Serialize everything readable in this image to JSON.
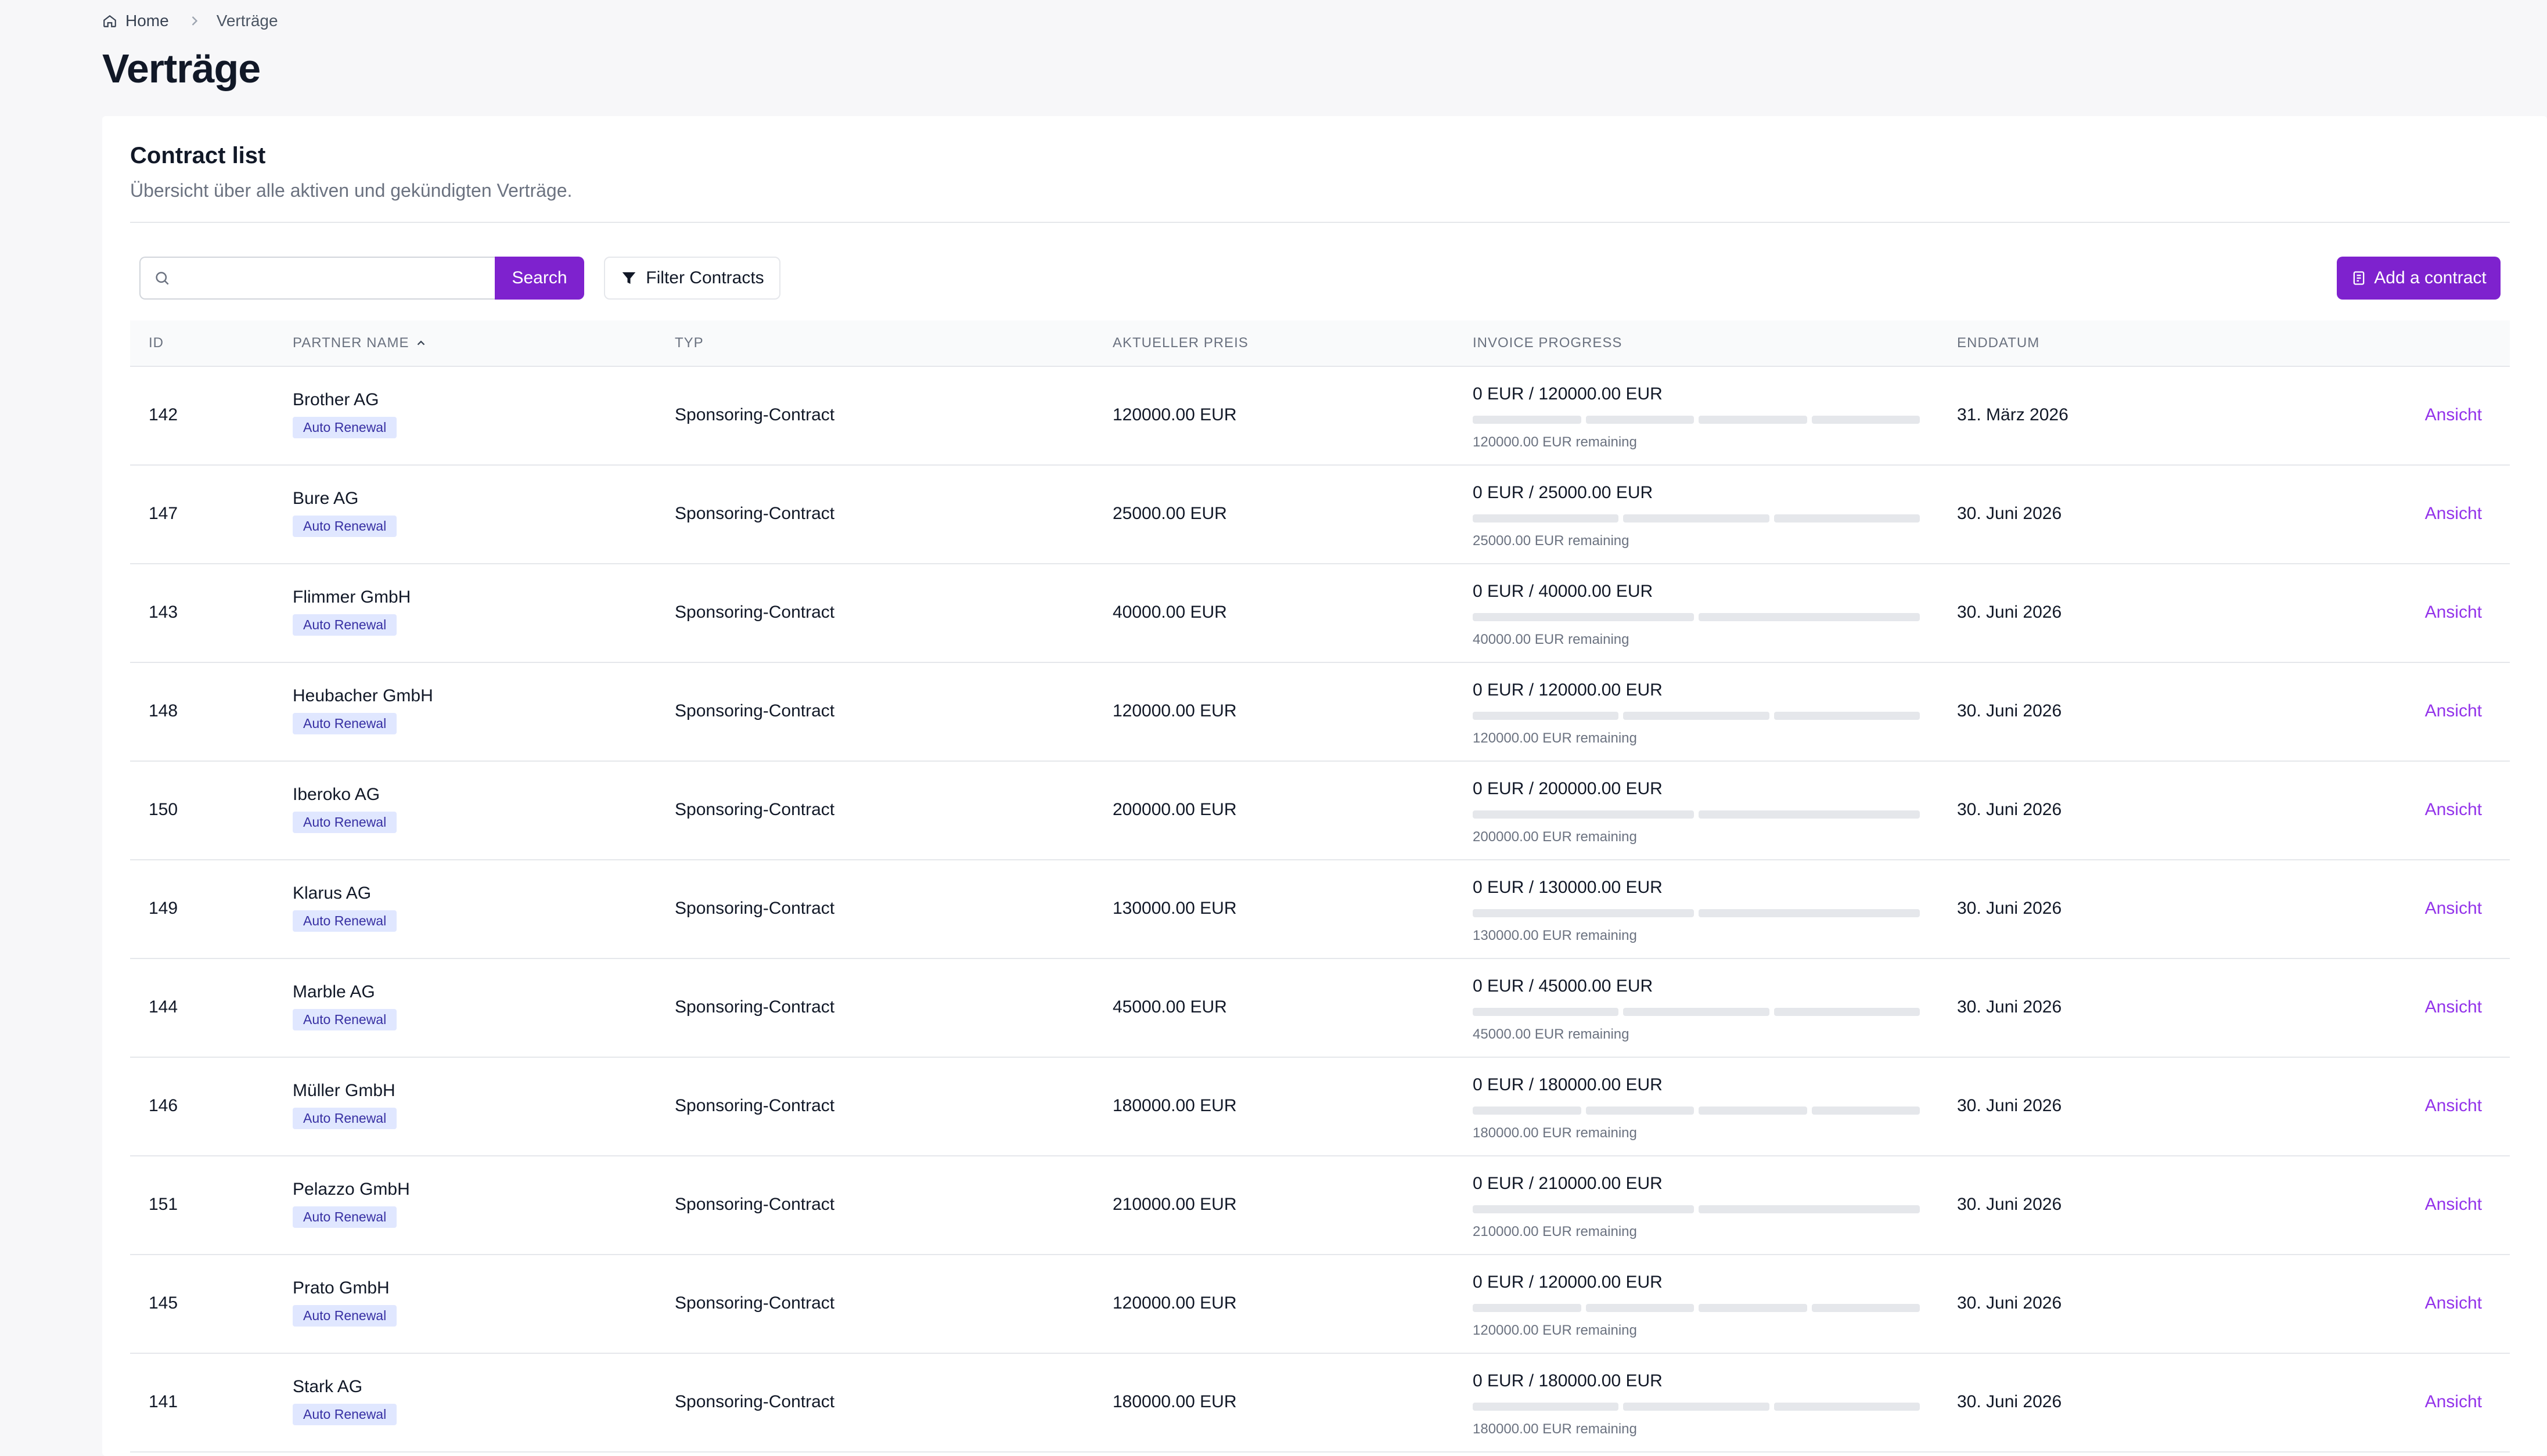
{
  "breadcrumb": {
    "home": "Home",
    "current": "Verträge"
  },
  "page": {
    "title": "Verträge"
  },
  "card": {
    "title": "Contract list",
    "subtitle": "Übersicht über alle aktiven und gekündigten Verträge."
  },
  "toolbar": {
    "search_placeholder": "",
    "search_label": "Search",
    "filter_label": "Filter Contracts",
    "add_label": "Add a contract"
  },
  "table": {
    "headers": {
      "id": "ID",
      "partner": "PARTNER NAME",
      "type": "TYP",
      "price": "AKTUELLER PREIS",
      "progress": "INVOICE PROGRESS",
      "end": "ENDDATUM"
    },
    "rows": [
      {
        "id": "142",
        "partner": "Brother AG",
        "badge": "Auto Renewal",
        "type": "Sponsoring-Contract",
        "price": "120000.00 EUR",
        "progress": "0 EUR / 120000.00 EUR",
        "segments": 4,
        "filled": 0,
        "remaining": "120000.00 EUR remaining",
        "end": "31. März 2026",
        "action": "Ansicht"
      },
      {
        "id": "147",
        "partner": "Bure AG",
        "badge": "Auto Renewal",
        "type": "Sponsoring-Contract",
        "price": "25000.00 EUR",
        "progress": "0 EUR / 25000.00 EUR",
        "segments": 3,
        "filled": 0,
        "remaining": "25000.00 EUR remaining",
        "end": "30. Juni 2026",
        "action": "Ansicht"
      },
      {
        "id": "143",
        "partner": "Flimmer GmbH",
        "badge": "Auto Renewal",
        "type": "Sponsoring-Contract",
        "price": "40000.00 EUR",
        "progress": "0 EUR / 40000.00 EUR",
        "segments": 2,
        "filled": 0,
        "remaining": "40000.00 EUR remaining",
        "end": "30. Juni 2026",
        "action": "Ansicht"
      },
      {
        "id": "148",
        "partner": "Heubacher GmbH",
        "badge": "Auto Renewal",
        "type": "Sponsoring-Contract",
        "price": "120000.00 EUR",
        "progress": "0 EUR / 120000.00 EUR",
        "segments": 3,
        "filled": 0,
        "remaining": "120000.00 EUR remaining",
        "end": "30. Juni 2026",
        "action": "Ansicht"
      },
      {
        "id": "150",
        "partner": "Iberoko AG",
        "badge": "Auto Renewal",
        "type": "Sponsoring-Contract",
        "price": "200000.00 EUR",
        "progress": "0 EUR / 200000.00 EUR",
        "segments": 2,
        "filled": 0,
        "remaining": "200000.00 EUR remaining",
        "end": "30. Juni 2026",
        "action": "Ansicht"
      },
      {
        "id": "149",
        "partner": "Klarus AG",
        "badge": "Auto Renewal",
        "type": "Sponsoring-Contract",
        "price": "130000.00 EUR",
        "progress": "0 EUR / 130000.00 EUR",
        "segments": 2,
        "filled": 0,
        "remaining": "130000.00 EUR remaining",
        "end": "30. Juni 2026",
        "action": "Ansicht"
      },
      {
        "id": "144",
        "partner": "Marble AG",
        "badge": "Auto Renewal",
        "type": "Sponsoring-Contract",
        "price": "45000.00 EUR",
        "progress": "0 EUR / 45000.00 EUR",
        "segments": 3,
        "filled": 0,
        "remaining": "45000.00 EUR remaining",
        "end": "30. Juni 2026",
        "action": "Ansicht"
      },
      {
        "id": "146",
        "partner": "Müller GmbH",
        "badge": "Auto Renewal",
        "type": "Sponsoring-Contract",
        "price": "180000.00 EUR",
        "progress": "0 EUR / 180000.00 EUR",
        "segments": 4,
        "filled": 0,
        "remaining": "180000.00 EUR remaining",
        "end": "30. Juni 2026",
        "action": "Ansicht"
      },
      {
        "id": "151",
        "partner": "Pelazzo GmbH",
        "badge": "Auto Renewal",
        "type": "Sponsoring-Contract",
        "price": "210000.00 EUR",
        "progress": "0 EUR / 210000.00 EUR",
        "segments": 2,
        "filled": 0,
        "remaining": "210000.00 EUR remaining",
        "end": "30. Juni 2026",
        "action": "Ansicht"
      },
      {
        "id": "145",
        "partner": "Prato GmbH",
        "badge": "Auto Renewal",
        "type": "Sponsoring-Contract",
        "price": "120000.00 EUR",
        "progress": "0 EUR / 120000.00 EUR",
        "segments": 4,
        "filled": 0,
        "remaining": "120000.00 EUR remaining",
        "end": "30. Juni 2026",
        "action": "Ansicht"
      },
      {
        "id": "141",
        "partner": "Stark AG",
        "badge": "Auto Renewal",
        "type": "Sponsoring-Contract",
        "price": "180000.00 EUR",
        "progress": "0 EUR / 180000.00 EUR",
        "segments": 3,
        "filled": 0,
        "remaining": "180000.00 EUR remaining",
        "end": "30. Juni 2026",
        "action": "Ansicht"
      }
    ]
  },
  "colors": {
    "accent": "#7e22ce",
    "link": "#9333ea",
    "badge_bg": "#e0e7ff",
    "badge_text": "#3730a3",
    "segment": "#e5e7eb"
  }
}
